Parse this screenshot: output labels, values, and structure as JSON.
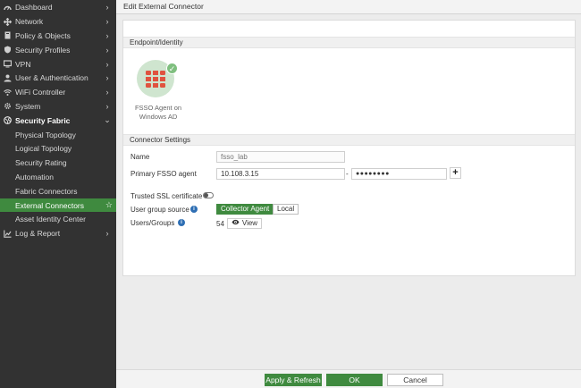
{
  "sidebar": {
    "items": [
      {
        "label": "Dashboard",
        "icon": "dashboard-icon"
      },
      {
        "label": "Network",
        "icon": "network-icon"
      },
      {
        "label": "Policy & Objects",
        "icon": "policy-icon"
      },
      {
        "label": "Security Profiles",
        "icon": "shield-icon"
      },
      {
        "label": "VPN",
        "icon": "monitor-icon"
      },
      {
        "label": "User & Authentication",
        "icon": "user-icon"
      },
      {
        "label": "WiFi Controller",
        "icon": "wifi-icon"
      },
      {
        "label": "System",
        "icon": "gear-icon"
      },
      {
        "label": "Security Fabric",
        "icon": "fabric-icon"
      },
      {
        "label": "Physical Topology"
      },
      {
        "label": "Logical Topology"
      },
      {
        "label": "Security Rating"
      },
      {
        "label": "Automation"
      },
      {
        "label": "Fabric Connectors"
      },
      {
        "label": "External Connectors"
      },
      {
        "label": "Asset Identity Center"
      },
      {
        "label": "Log & Report",
        "icon": "chart-icon"
      }
    ]
  },
  "header": {
    "title": "Edit External Connector"
  },
  "form": {
    "section_endpoint": "Endpoint/Identity",
    "tile_label_line1": "FSSO Agent on",
    "tile_label_line2": "Windows AD",
    "section_settings": "Connector Settings",
    "name_label": "Name",
    "name_placeholder": "fsso_lab",
    "primary_label": "Primary FSSO agent",
    "primary_ip": "10.108.3.15",
    "separator": "-",
    "password_mask": "●●●●●●●●",
    "plus_label": "+",
    "ssl_label": "Trusted SSL certificate",
    "user_group_label": "User group source",
    "collector_agent": "Collector Agent",
    "local": "Local",
    "users_groups_label": "Users/Groups",
    "users_count": "54",
    "view_label": "View"
  },
  "footer": {
    "apply_refresh": "Apply & Refresh",
    "ok": "OK",
    "cancel": "Cancel"
  },
  "colors": {
    "accent": "#3f8a3f",
    "sidebar_bg": "#323232"
  }
}
